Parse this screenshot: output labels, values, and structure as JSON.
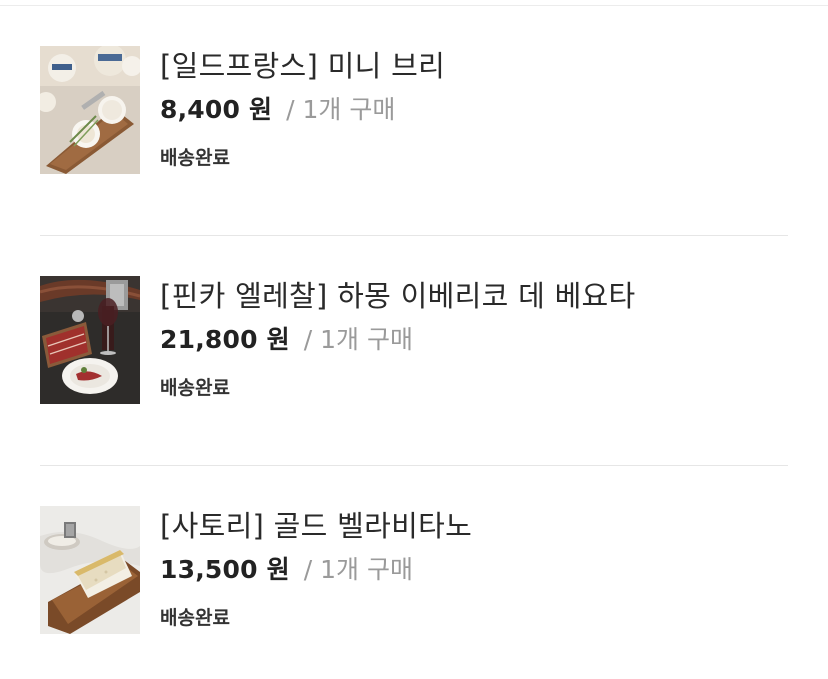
{
  "orders": [
    {
      "name": "[일드프랑스] 미니 브리",
      "price": "8,400 원",
      "qty": "/ 1개 구매",
      "status": "배송완료",
      "thumb_icon": "brie-cheese-photo"
    },
    {
      "name": "[핀카 엘레찰] 하몽 이베리코 데 베요타",
      "price": "21,800 원",
      "qty": "/ 1개 구매",
      "status": "배송완료",
      "thumb_icon": "jamon-iberico-photo"
    },
    {
      "name": "[사토리] 골드 벨라비타노",
      "price": "13,500 원",
      "qty": "/ 1개 구매",
      "status": "배송완료",
      "thumb_icon": "bellavitano-cheese-photo"
    }
  ],
  "colors": {
    "text": "#222222",
    "muted": "#9a9a9a",
    "divider": "#e6e6e6"
  }
}
